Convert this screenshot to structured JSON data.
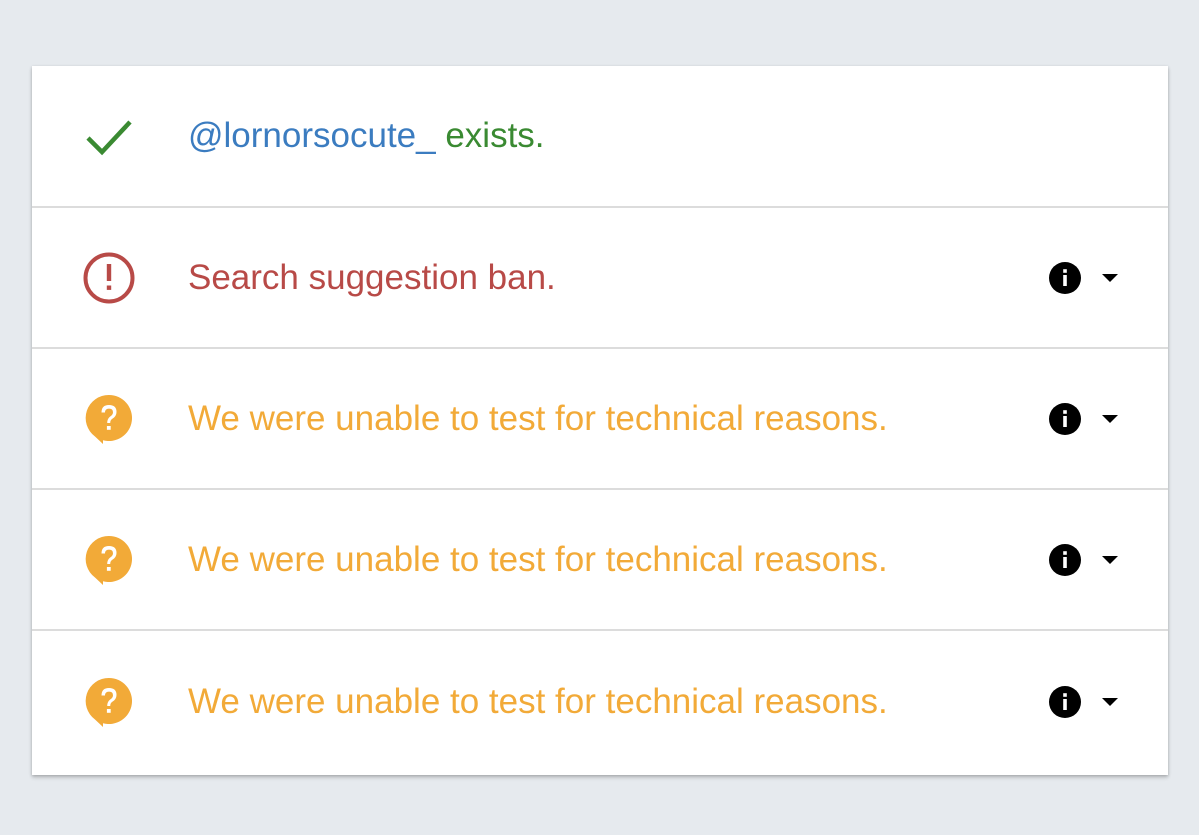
{
  "results": {
    "exists": {
      "icon": "check-icon",
      "handle": "@lornorsocute_",
      "text": " exists."
    },
    "search_suggestion": {
      "icon": "alert-circle-icon",
      "text": "Search suggestion ban."
    },
    "test1": {
      "icon": "question-bubble-icon",
      "text": "We were unable to test for technical reasons."
    },
    "test2": {
      "icon": "question-bubble-icon",
      "text": "We were unable to test for technical reasons."
    },
    "test3": {
      "icon": "question-bubble-icon",
      "text": "We were unable to test for technical reasons."
    }
  },
  "colors": {
    "background": "#e6eaee",
    "handle": "#3b7cc0",
    "success": "#3a8a32",
    "ban": "#b84a47",
    "unknown": "#f2aa38"
  }
}
